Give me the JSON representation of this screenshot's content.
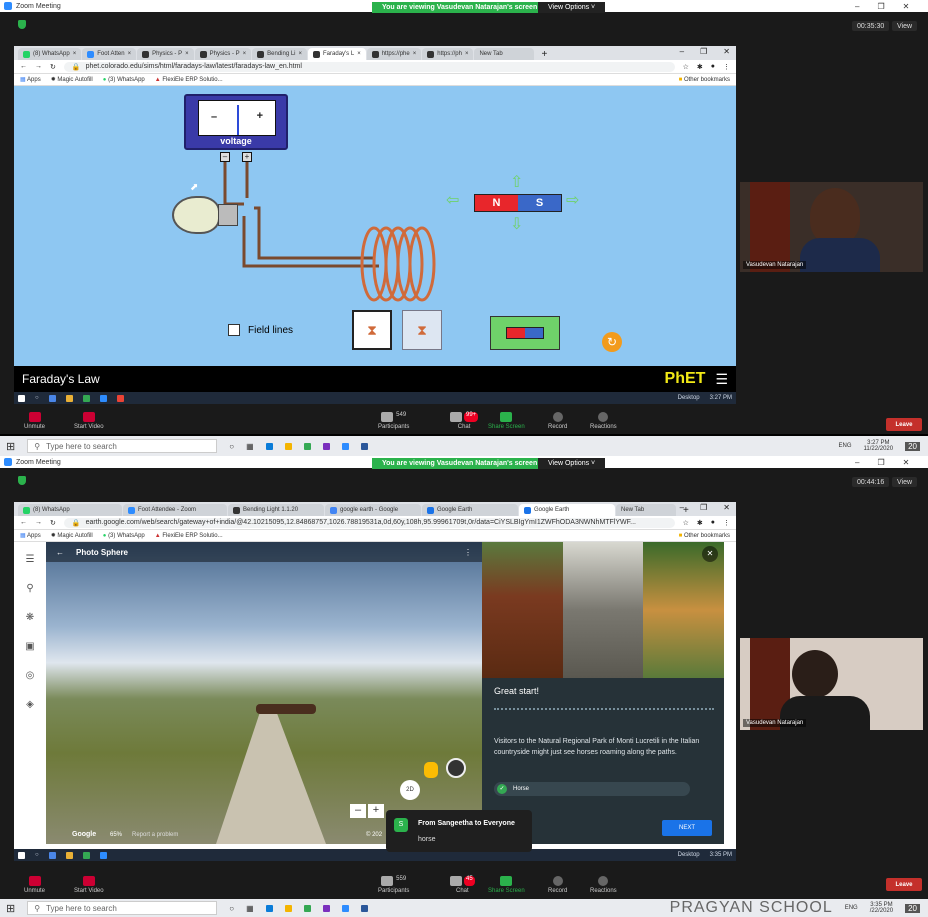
{
  "top": {
    "zoom_title": "Zoom Meeting",
    "banner": "You are viewing Vasudevan Natarajan's screen",
    "view_options": "View Options ˅",
    "timer": "00:35:30",
    "view": "View",
    "tabs": [
      "(8) WhatsApp",
      "Foot Atten",
      "Physics - P",
      "Physics - P",
      "Bending Li",
      "Faraday's L",
      "https://phe",
      "https://ph",
      "New Tab"
    ],
    "url": "phet.colorado.edu/sims/html/faradays-law/latest/faradays-law_en.html",
    "bookmarks": [
      "Apps",
      "Magic Autofill",
      "(3) WhatsApp",
      "FlexiEle ERP Solutio..."
    ],
    "other_bookmarks": "Other bookmarks",
    "sim": {
      "voltage": "voltage",
      "field_lines": "Field lines",
      "title": "Faraday's Law",
      "phet": "PhET",
      "magnet_n": "N",
      "magnet_s": "S"
    },
    "taskbar_right": [
      "Desktop",
      "3:27 PM"
    ],
    "video_name": "Vasudevan Natarajan",
    "controls": {
      "unmute": "Unmute",
      "start_video": "Start Video",
      "participants": "Participants",
      "participants_count": "549",
      "chat": "Chat",
      "chat_count": "99+",
      "share": "Share Screen",
      "record": "Record",
      "reactions": "Reactions",
      "leave": "Leave"
    },
    "win": {
      "search": "Type here to search",
      "lang": "ENG",
      "region": "IN",
      "time": "3:27 PM",
      "date": "11/22/2020",
      "notif": "20"
    }
  },
  "bottom": {
    "zoom_title": "Zoom Meeting",
    "banner": "You are viewing Vasudevan Natarajan's screen",
    "view_options": "View Options ˅",
    "timer": "00:44:16",
    "view": "View",
    "tabs": [
      "(8) WhatsApp",
      "Foot Attendee - Zoom",
      "Bending Light 1.1.20",
      "google earth - Google",
      "Google Earth",
      "Google Earth",
      "New Tab"
    ],
    "url": "earth.google.com/web/search/gateway+of+india/@42.10215095,12.84868757,1026.78819531a,0d,60y,108h,95.99961709t,0r/data=CiYSLBIgYmI1ZWFhODA3NWNhMTFlYWF...",
    "bookmarks": [
      "Apps",
      "Magic Autofill",
      "(3) WhatsApp",
      "FlexiEle ERP Solutio..."
    ],
    "other_bookmarks": "Other bookmarks",
    "earth": {
      "photo_sphere": "Photo Sphere",
      "great_start": "Great start!",
      "description": "Visitors to the Natural Regional Park of Monti Lucretili in the Italian countryside might just see horses roaming along the paths.",
      "answer": "Horse",
      "next": "NEXT",
      "google": "Google",
      "zoom_pct": "65%",
      "report": "Report a problem",
      "mode": "2D",
      "copyright": "© 202"
    },
    "chat_popup": {
      "avatar": "S",
      "from": "From Sangeetha to Everyone",
      "message": "horse"
    },
    "taskbar_right": [
      "Desktop",
      "3:35 PM"
    ],
    "video_name": "Vasudevan Natarajan",
    "controls": {
      "unmute": "Unmute",
      "start_video": "Start Video",
      "participants": "Participants",
      "participants_count": "559",
      "chat": "Chat",
      "chat_count": "45",
      "share": "Share Screen",
      "record": "Record",
      "reactions": "Reactions",
      "leave": "Leave"
    },
    "win": {
      "search": "Type here to search",
      "lang": "ENG",
      "time": "3:35 PM",
      "date": "/22/2020",
      "notif": "20",
      "watermark": "PRAGYAN SCHOOL"
    }
  },
  "colors": {
    "sim_bg": "#8ec7f2",
    "phet_bar": "#000000",
    "zoom_green": "#2bb24c",
    "leave_red": "#c4302b",
    "earth_panel": "#263238",
    "earth_accent": "#1a73e8"
  }
}
